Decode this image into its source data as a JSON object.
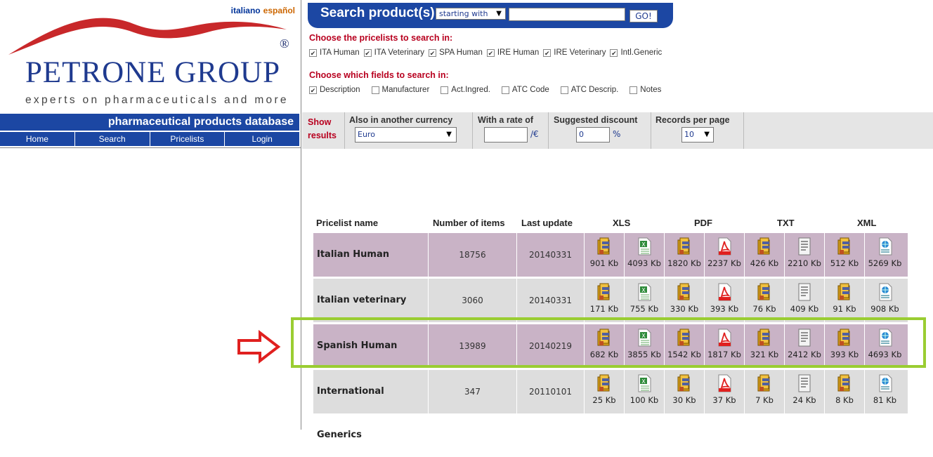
{
  "languages": {
    "italian": "italiano",
    "spanish": "español"
  },
  "logo": {
    "registered": "®",
    "brand": "PETRONE GROUP",
    "tagline": "experts on pharmaceuticals and more"
  },
  "sidebar": {
    "title": "pharmaceutical products database",
    "nav": [
      "Home",
      "Search",
      "Pricelists",
      "Login"
    ]
  },
  "search": {
    "label": "Search product(s):",
    "mode": "starting with",
    "query": "",
    "go": "GO!"
  },
  "pricelists": {
    "label": "Choose the pricelists to search in:",
    "items": [
      {
        "label": "ITA Human",
        "checked": true
      },
      {
        "label": "ITA Veterinary",
        "checked": true
      },
      {
        "label": "SPA Human",
        "checked": true
      },
      {
        "label": "IRE Human",
        "checked": true
      },
      {
        "label": "IRE Veterinary",
        "checked": true
      },
      {
        "label": "Intl.Generic",
        "checked": true
      }
    ]
  },
  "fields": {
    "label": "Choose which fields to search in:",
    "items": [
      {
        "label": "Description",
        "checked": true
      },
      {
        "label": "Manufacturer",
        "checked": false
      },
      {
        "label": "Act.Ingred.",
        "checked": false
      },
      {
        "label": "ATC Code",
        "checked": false
      },
      {
        "label": "ATC Descrip.",
        "checked": false
      },
      {
        "label": "Notes",
        "checked": false
      }
    ]
  },
  "results_bar": {
    "show_results": "Show results",
    "currency_label": "Also in another currency",
    "currency_value": "Euro",
    "rate_label": "With a rate of",
    "rate_value": "",
    "rate_unit": "/€",
    "discount_label": "Suggested discount",
    "discount_value": "0",
    "discount_unit": "%",
    "records_label": "Records per page",
    "records_value": "10"
  },
  "table": {
    "headers": {
      "name": "Pricelist name",
      "items": "Number of items",
      "updated": "Last update",
      "xls": "XLS",
      "pdf": "PDF",
      "txt": "TXT",
      "xml": "XML"
    },
    "rows": [
      {
        "name": "Italian Human",
        "items": "18756",
        "updated": "20140331",
        "sizes": [
          "901 Kb",
          "4093 Kb",
          "1820 Kb",
          "2237 Kb",
          "426 Kb",
          "2210 Kb",
          "512 Kb",
          "5269 Kb"
        ]
      },
      {
        "name": "Italian veterinary",
        "items": "3060",
        "updated": "20140331",
        "sizes": [
          "171 Kb",
          "755 Kb",
          "330 Kb",
          "393 Kb",
          "76 Kb",
          "409 Kb",
          "91 Kb",
          "908 Kb"
        ]
      },
      {
        "name": "Spanish Human",
        "items": "13989",
        "updated": "20140219",
        "sizes": [
          "682 Kb",
          "3855 Kb",
          "1542 Kb",
          "1817 Kb",
          "321 Kb",
          "2412 Kb",
          "393 Kb",
          "4693 Kb"
        ]
      },
      {
        "name": "International Generics",
        "items": "347",
        "updated": "20110101",
        "sizes": [
          "25 Kb",
          "100 Kb",
          "30 Kb",
          "37 Kb",
          "7 Kb",
          "24 Kb",
          "8 Kb",
          "81 Kb"
        ]
      }
    ]
  },
  "colors": {
    "brand_blue": "#1c47a3",
    "accent_red": "#b8001f",
    "highlight_green": "#9acd32",
    "row_purple": "#c9b3c6",
    "row_gray": "#dddddd"
  },
  "icons": [
    "zip-archive-icon",
    "excel-file-icon",
    "pdf-file-icon",
    "text-file-icon",
    "xml-file-icon",
    "red-arrow-icon"
  ]
}
